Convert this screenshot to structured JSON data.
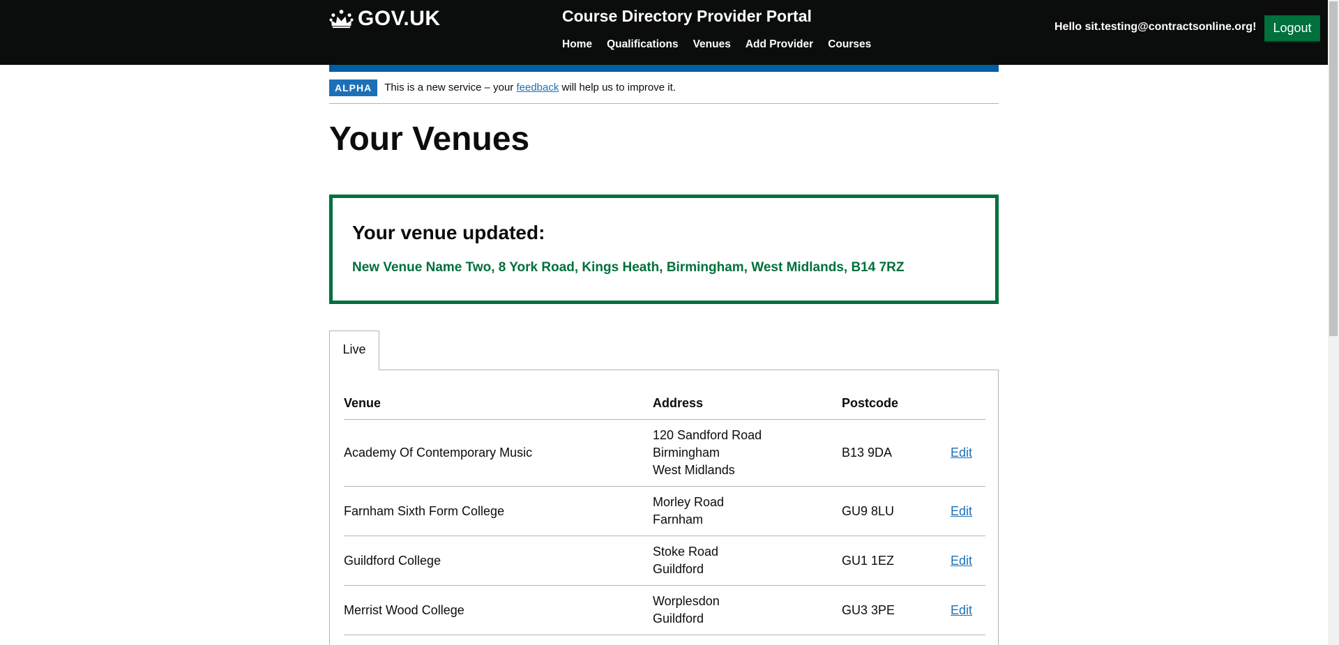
{
  "header": {
    "logo_text": "GOV.UK",
    "service_name": "Course Directory Provider Portal",
    "nav": [
      {
        "label": "Home"
      },
      {
        "label": "Qualifications"
      },
      {
        "label": "Venues"
      },
      {
        "label": "Add Provider"
      },
      {
        "label": "Courses"
      }
    ],
    "greeting": "Hello sit.testing@contractsonline.org!",
    "logout_label": "Logout"
  },
  "phase_banner": {
    "tag": "ALPHA",
    "text_before": "This is a new service – your ",
    "link_text": "feedback",
    "text_after": " will help us to improve it."
  },
  "page_title": "Your Venues",
  "success": {
    "heading": "Your venue updated:",
    "body": "New Venue Name Two, 8 York Road, Kings Heath, Birmingham, West Midlands, B14 7RZ"
  },
  "tabs": [
    {
      "label": "Live"
    }
  ],
  "table": {
    "headers": {
      "venue": "Venue",
      "address": "Address",
      "postcode": "Postcode"
    },
    "rows": [
      {
        "venue": "Academy Of Contemporary Music",
        "address": [
          "120 Sandford Road",
          "Birmingham",
          "West Midlands"
        ],
        "postcode": "B13 9DA",
        "action": "Edit"
      },
      {
        "venue": "Farnham Sixth Form College",
        "address": [
          "Morley Road",
          "Farnham"
        ],
        "postcode": "GU9 8LU",
        "action": "Edit"
      },
      {
        "venue": "Guildford College",
        "address": [
          "Stoke Road",
          "Guildford"
        ],
        "postcode": "GU1 1EZ",
        "action": "Edit"
      },
      {
        "venue": "Merrist Wood College",
        "address": [
          "Worplesdon",
          "Guildford"
        ],
        "postcode": "GU3 3PE",
        "action": "Edit"
      }
    ]
  },
  "colors": {
    "header_bg": "#0b0c0c",
    "brand_blue": "#005ea5",
    "link_blue": "#1d70b8",
    "success_green": "#00703c"
  }
}
